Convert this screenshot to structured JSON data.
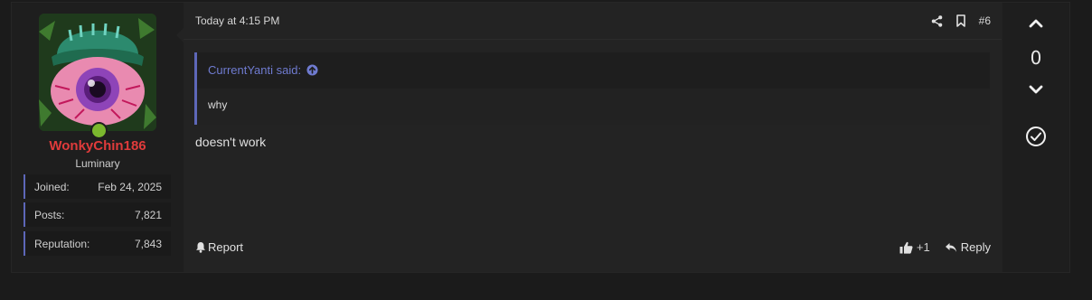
{
  "user": {
    "username": "WonkyChin186",
    "title": "Luminary",
    "online": true,
    "username_color": "#e03b3b",
    "stats": [
      {
        "label": "Joined:",
        "value": "Feb 24, 2025"
      },
      {
        "label": "Posts:",
        "value": "7,821"
      },
      {
        "label": "Reputation:",
        "value": "7,843"
      }
    ]
  },
  "post": {
    "timestamp": "Today at 4:15 PM",
    "post_number": "#6",
    "quote": {
      "author_line": "CurrentYanti said:",
      "text": "why"
    },
    "body": "doesn't work",
    "report_label": "Report",
    "reaction_count": "+1",
    "reply_label": "Reply"
  },
  "votes": {
    "score": "0"
  },
  "icons": {
    "share": "share-icon",
    "bookmark": "bookmark-icon",
    "quote_link": "arrow-up-circle-icon",
    "report": "bell-icon",
    "like": "thumbs-up-icon",
    "reply": "reply-icon",
    "vote_up": "chevron-up-icon",
    "vote_down": "chevron-down-icon",
    "solution": "check-circle-icon"
  },
  "colors": {
    "accent": "#5d67b8",
    "quote_author": "#6f7bd0",
    "online": "#7bb82e"
  }
}
